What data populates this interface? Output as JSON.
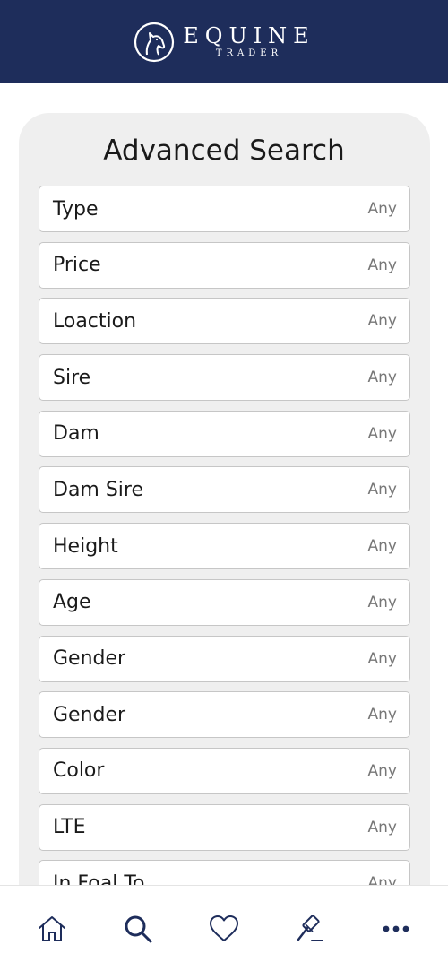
{
  "header": {
    "brand_main": "EQUINE",
    "brand_sub": "TRADER",
    "logo_icon": "horse-head-icon",
    "background_color": "#1e2d5b"
  },
  "search": {
    "title": "Advanced Search",
    "filters": [
      {
        "label": "Type",
        "value": "Any"
      },
      {
        "label": "Price",
        "value": "Any"
      },
      {
        "label": "Loaction",
        "value": "Any"
      },
      {
        "label": "Sire",
        "value": "Any"
      },
      {
        "label": "Dam",
        "value": "Any"
      },
      {
        "label": "Dam Sire",
        "value": "Any"
      },
      {
        "label": "Height",
        "value": "Any"
      },
      {
        "label": "Age",
        "value": "Any"
      },
      {
        "label": "Gender",
        "value": "Any"
      },
      {
        "label": "Gender",
        "value": "Any"
      },
      {
        "label": "Color",
        "value": "Any"
      },
      {
        "label": "LTE",
        "value": "Any"
      },
      {
        "label": "In Foal To",
        "value": "Any"
      }
    ]
  },
  "nav": {
    "items": [
      {
        "icon": "home-icon"
      },
      {
        "icon": "search-icon"
      },
      {
        "icon": "heart-icon"
      },
      {
        "icon": "gavel-icon"
      },
      {
        "icon": "more-icon"
      }
    ],
    "icon_color": "#1e2d5b"
  }
}
